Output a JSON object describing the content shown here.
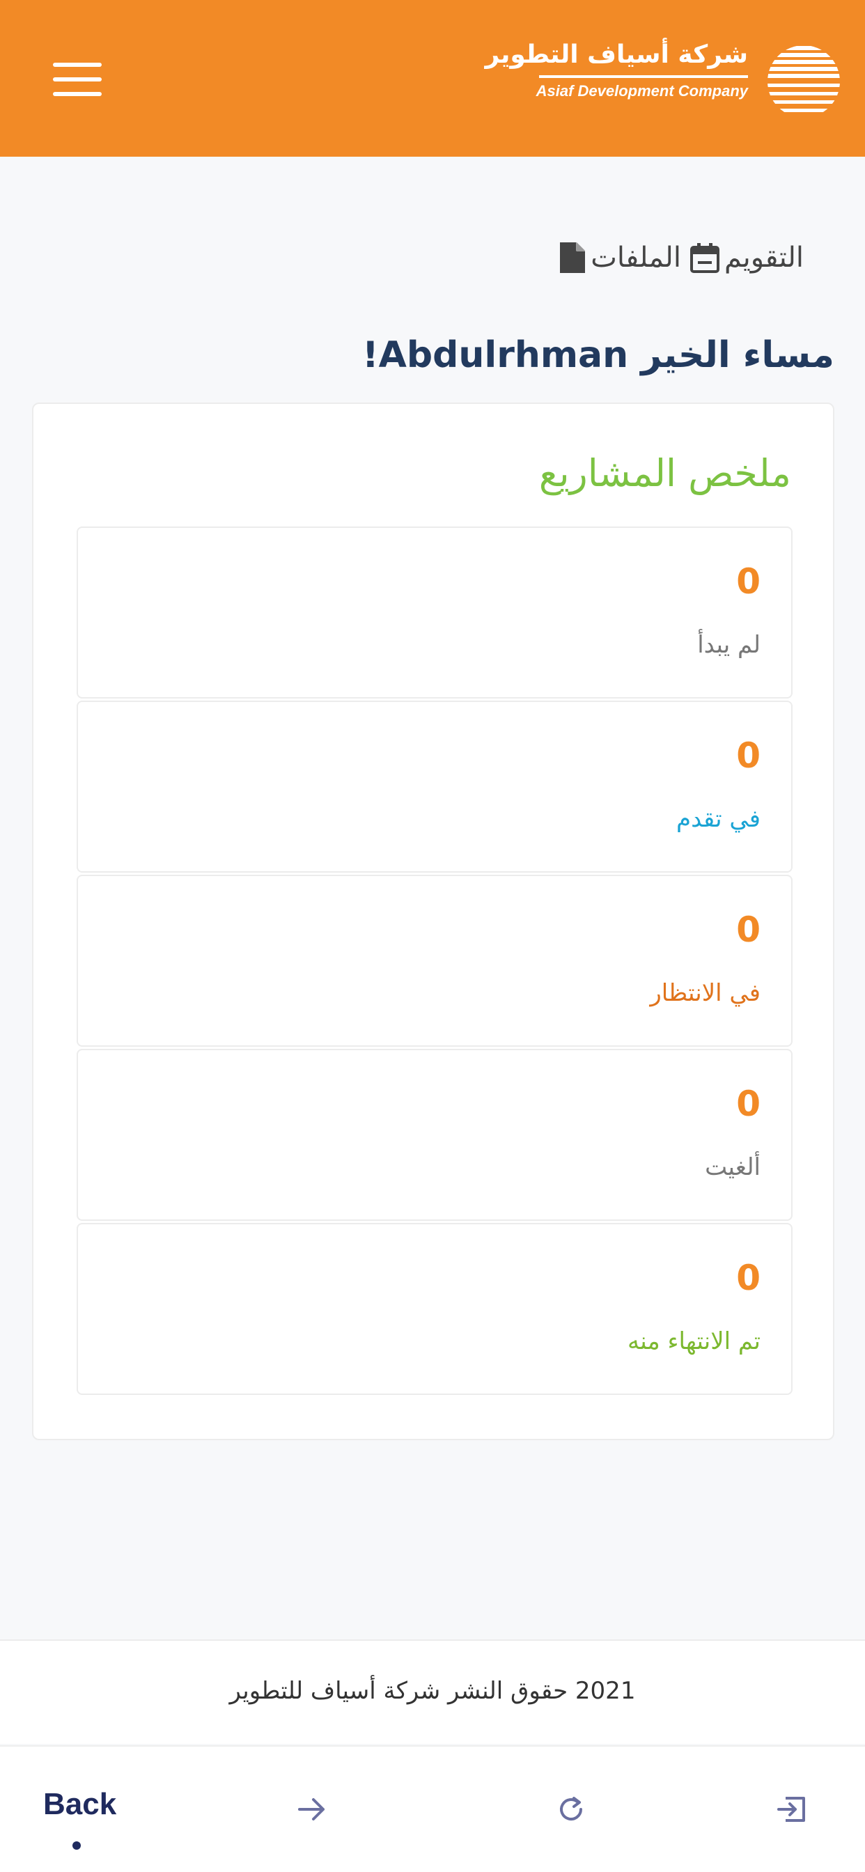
{
  "header": {
    "logo_arabic": "شركة أسياف التطوير",
    "logo_english": "Asiaf Development Company",
    "menu_icon": "hamburger-menu-icon",
    "background_color": "#f28a26"
  },
  "tabs": [
    {
      "label": "الملفات",
      "icon": "file-icon"
    },
    {
      "label": "التقويم",
      "icon": "calendar-icon"
    }
  ],
  "greeting": "مساء الخير Abdulrhman!",
  "summary": {
    "title": "ملخص المشاريع",
    "title_color": "#7cc242",
    "items": [
      {
        "value": "0",
        "label": "لم يبدأ",
        "color": "#777777"
      },
      {
        "value": "0",
        "label": "في تقدم",
        "color": "#1aa3d4"
      },
      {
        "value": "0",
        "label": "في الانتظار",
        "color": "#e0731c"
      },
      {
        "value": "0",
        "label": "ألغيت",
        "color": "#777777"
      },
      {
        "value": "0",
        "label": "تم الانتهاء منه",
        "color": "#7cb82f"
      }
    ]
  },
  "footer": {
    "copyright": "2021 حقوق النشر شركة أسياف للتطوير"
  },
  "navbar": {
    "back_label": "Back",
    "forward_icon": "arrow-right-icon",
    "refresh_icon": "refresh-icon",
    "exit_icon": "exit-icon"
  }
}
